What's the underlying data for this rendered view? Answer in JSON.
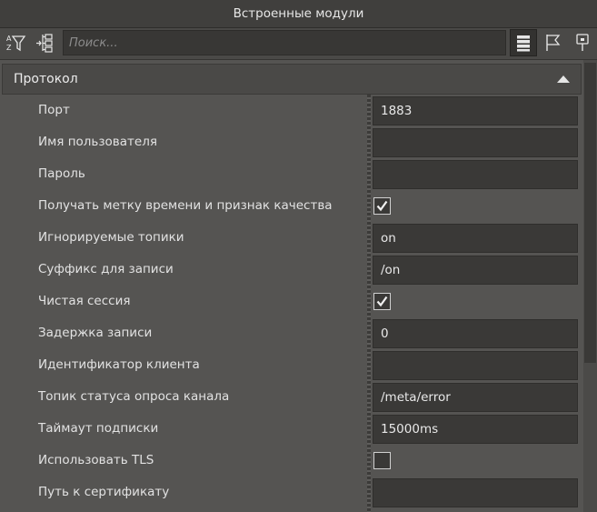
{
  "window": {
    "title": "Встроенные модули"
  },
  "toolbar": {
    "sort_icon": "sort-filter-icon",
    "collapse_icon": "collapse-tree-icon",
    "search_placeholder": "Поиск...",
    "list_icon": "list-view-icon",
    "flag_icon": "flag-icon",
    "pin_icon": "pin-icon"
  },
  "section": {
    "title": "Протокол",
    "expanded": true
  },
  "properties": [
    {
      "label": "Порт",
      "type": "text",
      "value": "1883"
    },
    {
      "label": "Имя пользователя",
      "type": "text",
      "value": ""
    },
    {
      "label": "Пароль",
      "type": "text",
      "value": ""
    },
    {
      "label": "Получать метку времени и признак качества",
      "type": "checkbox",
      "checked": true
    },
    {
      "label": "Игнорируемые топики",
      "type": "text",
      "value": "on"
    },
    {
      "label": "Суффикс для записи",
      "type": "text",
      "value": "/on"
    },
    {
      "label": "Чистая сессия",
      "type": "checkbox",
      "checked": true
    },
    {
      "label": "Задержка записи",
      "type": "text",
      "value": "0"
    },
    {
      "label": "Идентификатор клиента",
      "type": "text",
      "value": ""
    },
    {
      "label": "Топик статуса опроса канала",
      "type": "text",
      "value": "/meta/error"
    },
    {
      "label": "Таймаут подписки",
      "type": "text",
      "value": "15000ms"
    },
    {
      "label": "Использовать TLS",
      "type": "checkbox",
      "checked": false
    },
    {
      "label": "Путь к сертификату",
      "type": "text",
      "value": ""
    }
  ],
  "colors": {
    "background": "#555452",
    "field_background": "#3a3937",
    "text": "#e4e4e4"
  }
}
